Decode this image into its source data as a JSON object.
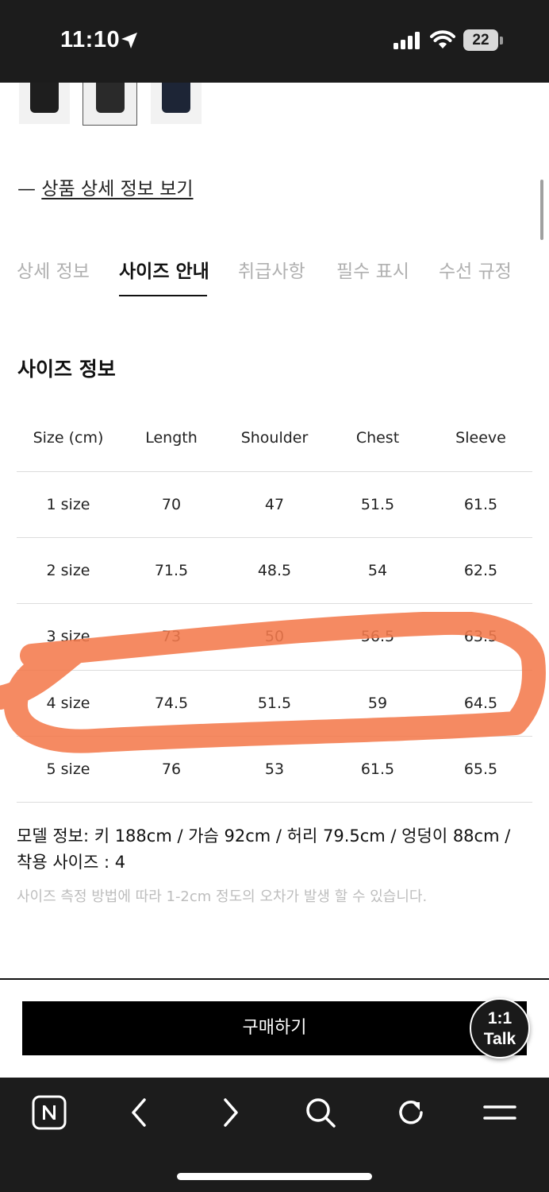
{
  "status_bar": {
    "time": "11:10",
    "battery": "22"
  },
  "detail_link": {
    "prefix": "— ",
    "label": "상품 상세 정보 보기"
  },
  "tabs": [
    {
      "label": "상세 정보",
      "active": false
    },
    {
      "label": "사이즈 안내",
      "active": true
    },
    {
      "label": "취급사항",
      "active": false
    },
    {
      "label": "필수 표시",
      "active": false
    },
    {
      "label": "수선 규정",
      "active": false
    }
  ],
  "section_title": "사이즈 정보",
  "size_table": {
    "headers": [
      "Size (cm)",
      "Length",
      "Shoulder",
      "Chest",
      "Sleeve"
    ],
    "rows": [
      [
        "1 size",
        "70",
        "47",
        "51.5",
        "61.5"
      ],
      [
        "2 size",
        "71.5",
        "48.5",
        "54",
        "62.5"
      ],
      [
        "3 size",
        "73",
        "50",
        "56.5",
        "63.5"
      ],
      [
        "4 size",
        "74.5",
        "51.5",
        "59",
        "64.5"
      ],
      [
        "5 size",
        "76",
        "53",
        "61.5",
        "65.5"
      ]
    ]
  },
  "annotation_color": "#f47a4c",
  "model_info": {
    "line1": "모델 정보: 키 188cm / 가슴 92cm / 허리 79.5cm / 엉덩이 88cm /",
    "line2": "착용 사이즈 : 4"
  },
  "note": "사이즈 측정 방법에 따라 1-2cm 정도의 오차가 발생 할 수 있습니다.",
  "buy_button": "구매하기",
  "talk_button": {
    "line1": "1:1",
    "line2": "Talk"
  },
  "toolbar_icons": [
    "naver-icon",
    "back-icon",
    "forward-icon",
    "search-icon",
    "refresh-icon",
    "menu-icon"
  ]
}
